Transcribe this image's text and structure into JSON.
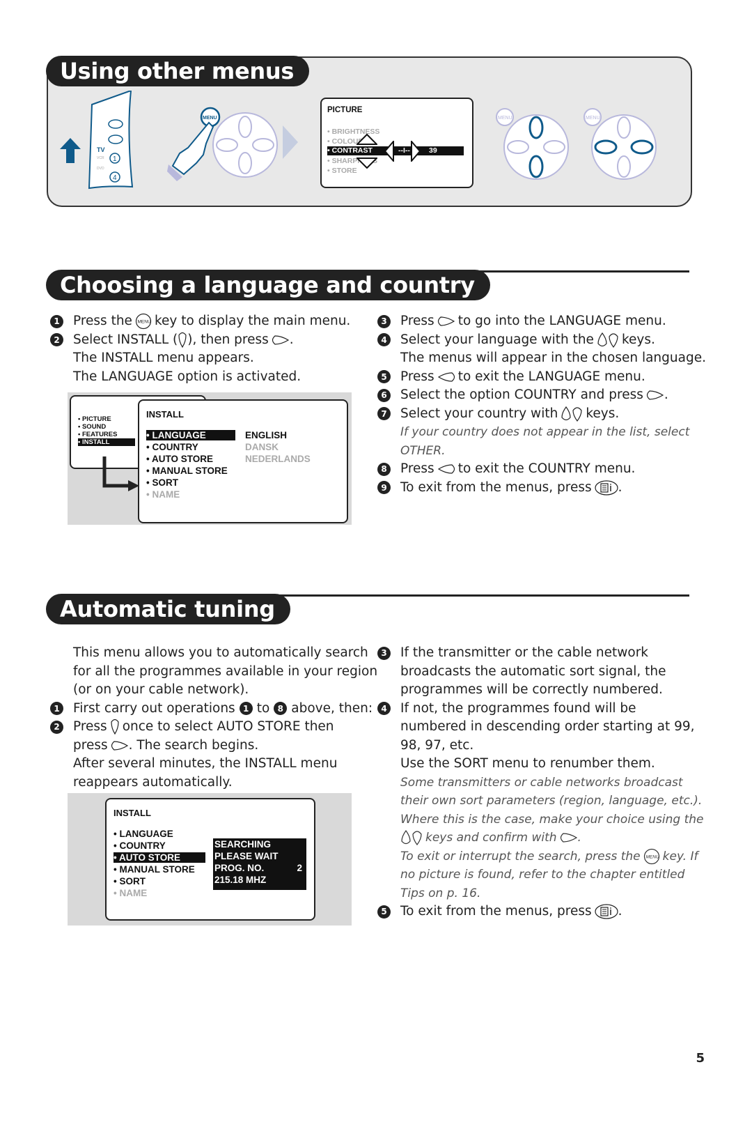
{
  "page_number": "5",
  "sections": {
    "other_menus": {
      "title": "Using other menus",
      "remote_labels": {
        "tv": "TV",
        "vcr": "VCR",
        "dvd": "DVD",
        "btn1": "1",
        "btn4": "4",
        "menu": "MENU"
      },
      "picture_menu": {
        "title": "PICTURE",
        "items": [
          "• BRIGHTNESS",
          "• COLOUR",
          "• CONTRAST",
          "• SHARPNESS",
          "• STORE"
        ],
        "selected_index": 2,
        "slider_text": "--I--",
        "value": "39"
      }
    },
    "language": {
      "title": "Choosing a language and country",
      "left_steps": [
        {
          "n": "1",
          "parts": [
            "Press the",
            "menu-key",
            "key to display the main menu."
          ]
        },
        {
          "n": "2",
          "parts": [
            "Select INSTALL (",
            "down-key",
            "), then press",
            "right-key",
            "."
          ]
        }
      ],
      "left_notes": [
        "The INSTALL menu appears.",
        "The LANGUAGE option is activated."
      ],
      "right_steps": [
        {
          "n": "3",
          "text_a": "Press",
          "text_b": "to go into the LANGUAGE menu."
        },
        {
          "n": "4",
          "text_a": "Select your language with the",
          "text_b": "keys."
        },
        {
          "note": "The menus will appear in the chosen language."
        },
        {
          "n": "5",
          "text_a": "Press",
          "text_b": "to exit the LANGUAGE menu."
        },
        {
          "n": "6",
          "text_a": "Select the option COUNTRY and press",
          "text_b": "."
        },
        {
          "n": "7",
          "text_a": "Select your country with",
          "text_b": "keys."
        },
        {
          "italic": "If your country does not appear in the list, select"
        },
        {
          "italic": "OTHER."
        },
        {
          "n": "8",
          "text_a": "Press",
          "text_b": "to exit the COUNTRY menu."
        },
        {
          "n": "9",
          "text_a": "To exit from the menus, press",
          "text_b": "."
        }
      ],
      "main_menu": {
        "items": [
          "• PICTURE",
          "• SOUND",
          "• FEATURES",
          "• INSTALL"
        ],
        "selected_index": 3
      },
      "install_menu": {
        "title": "INSTALL",
        "items": [
          "• LANGUAGE",
          "• COUNTRY",
          "• AUTO STORE",
          "• MANUAL STORE",
          "• SORT",
          "• NAME"
        ],
        "selected_index": 0,
        "languages": [
          "ENGLISH",
          "DANSK",
          "NEDERLANDS"
        ]
      }
    },
    "auto_tuning": {
      "title": "Automatic tuning",
      "intro": [
        "This menu allows you to automatically search",
        "for all the programmes available in your region",
        "(or on your cable network)."
      ],
      "step1": {
        "n": "1",
        "a": "First carry out operations",
        "b": "to",
        "c": "above, then:",
        "ref1": "1",
        "ref2": "8"
      },
      "step2": {
        "n": "2",
        "a": "Press",
        "b": "once to select AUTO STORE then",
        "c": "press",
        "d": ". The search begins."
      },
      "after": [
        "After several minutes, the INSTALL menu",
        "reappears automatically."
      ],
      "right": {
        "step3": {
          "n": "3",
          "lines": [
            "If the transmitter or the cable network",
            "broadcasts the automatic sort signal, the",
            "programmes will be correctly numbered."
          ]
        },
        "step4": {
          "n": "4",
          "lines": [
            "If not, the programmes found will be",
            "numbered in descending order starting at 99,",
            "98, 97, etc."
          ]
        },
        "sort_note": "Use the SORT menu to renumber them.",
        "italic_lines": [
          "Some transmitters or cable networks broadcast",
          "their own sort parameters (region, language, etc.).",
          "Where this is the case, make your choice using the"
        ],
        "italic_keys_a": "keys and confirm with",
        "italic_keys_b": ".",
        "italic_menu_a": "To exit or interrupt the search, press the",
        "italic_menu_b": "key. If",
        "italic_tail": [
          "no picture is found, refer to the chapter entitled",
          "Tips on p. 16."
        ],
        "step5": {
          "n": "5",
          "a": "To exit from the menus, press",
          "b": "."
        }
      },
      "install_menu": {
        "title": "INSTALL",
        "items": [
          "• LANGUAGE",
          "• COUNTRY",
          "• AUTO STORE",
          "• MANUAL STORE",
          "• SORT",
          "• NAME"
        ],
        "selected_index": 2,
        "status": {
          "line1": "SEARCHING",
          "line2": "PLEASE WAIT",
          "prog_label": "PROG. NO.",
          "prog_value": "2",
          "freq": "215.18 MHZ"
        }
      }
    }
  },
  "colors": {
    "accent_blue": "#0f5a8a",
    "pad_lavender": "#b8b8dc",
    "pill_black": "#222222",
    "panel_grey": "#e8e8e8"
  }
}
